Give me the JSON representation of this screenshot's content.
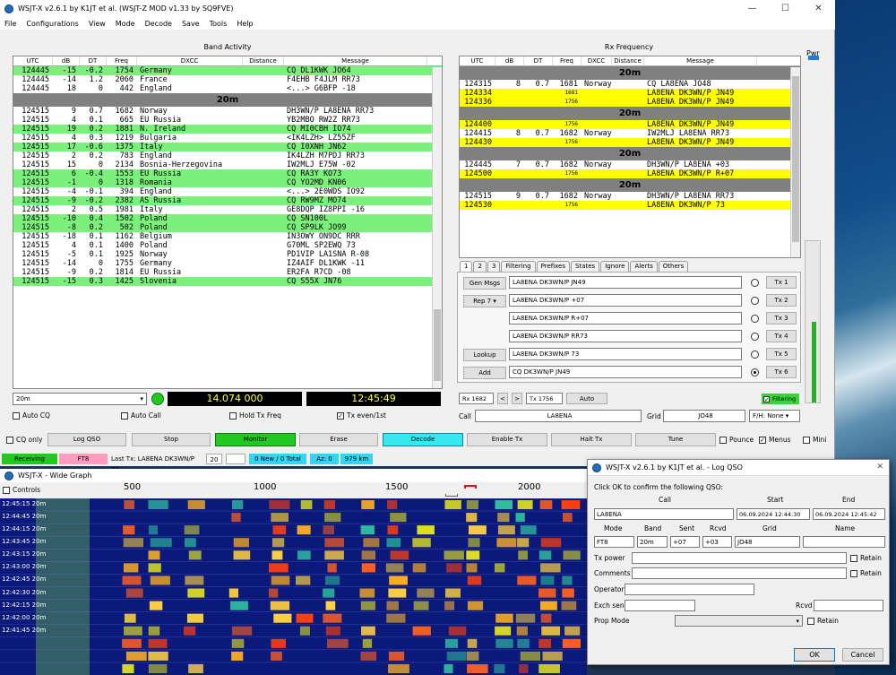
{
  "main": {
    "title": "WSJT-X   v2.6.1   by K1JT et al. (WSJT-Z MOD v1.33 by SQ9FVE)",
    "menu": [
      "File",
      "Configurations",
      "View",
      "Mode",
      "Decode",
      "Save",
      "Tools",
      "Help"
    ],
    "band_activity_title": "Band Activity",
    "rx_freq_title": "Rx Frequency",
    "pwr_label": "Pwr"
  },
  "band": {
    "headers": [
      "UTC",
      "dB",
      "DT",
      "Freq",
      "DXCC",
      "Distance",
      "Message"
    ],
    "rows": [
      {
        "t": "124445",
        "db": "-15",
        "dt": "-0.2",
        "f": "1754",
        "dx": "Germany",
        "dist": "",
        "msg": "CQ DL1KWK JO64",
        "c": "#7bf07b"
      },
      {
        "t": "124445",
        "db": "-14",
        "dt": "1.2",
        "f": "2060",
        "dx": "France",
        "dist": "",
        "msg": "F4EHB F4JLM RR73",
        "c": "#ffffff"
      },
      {
        "t": "124445",
        "db": "18",
        "dt": "0",
        "f": "442",
        "dx": "England",
        "dist": "",
        "msg": "<...> G6BFP -18",
        "c": "#ffffff"
      },
      {
        "sep": "20m"
      },
      {
        "t": "124515",
        "db": "9",
        "dt": "0.7",
        "f": "1682",
        "dx": "Norway",
        "dist": "",
        "msg": "DH3WN/P LA8ENA RR73",
        "c": "#ffffff"
      },
      {
        "t": "124515",
        "db": "4",
        "dt": "0.1",
        "f": "665",
        "dx": "EU Russia",
        "dist": "",
        "msg": "YB2MBO RW2Z RR73",
        "c": "#ffffff"
      },
      {
        "t": "124515",
        "db": "19",
        "dt": "0.2",
        "f": "1881",
        "dx": "N. Ireland",
        "dist": "",
        "msg": "CQ MI0CBH IO74",
        "c": "#7bf07b"
      },
      {
        "t": "124515",
        "db": "4",
        "dt": "0.3",
        "f": "1219",
        "dx": "Bulgaria",
        "dist": "",
        "msg": "<IK4LZH> LZ55ZF",
        "c": "#ffffff"
      },
      {
        "t": "124515",
        "db": "17",
        "dt": "-0.6",
        "f": "1375",
        "dx": "Italy",
        "dist": "",
        "msg": "CQ I0XNH JN62",
        "c": "#7bf07b"
      },
      {
        "t": "124515",
        "db": "2",
        "dt": "0.2",
        "f": "783",
        "dx": "England",
        "dist": "",
        "msg": "IK4LZH M7PDJ RR73",
        "c": "#ffffff"
      },
      {
        "t": "124515",
        "db": "15",
        "dt": "0",
        "f": "2134",
        "dx": "Bosnia-Herzegovina",
        "dist": "",
        "msg": "IW2MLJ E75W -02",
        "c": "#ffffff"
      },
      {
        "t": "124515",
        "db": "6",
        "dt": "-0.4",
        "f": "1553",
        "dx": "EU Russia",
        "dist": "",
        "msg": "CQ RA3Y KO73",
        "c": "#7bf07b"
      },
      {
        "t": "124515",
        "db": "-1",
        "dt": "0",
        "f": "1318",
        "dx": "Romania",
        "dist": "",
        "msg": "CQ YO2MD KN06",
        "c": "#7bf07b"
      },
      {
        "t": "124515",
        "db": "-4",
        "dt": "-0.1",
        "f": "394",
        "dx": "England",
        "dist": "",
        "msg": "<...> 2E0WDS IO92",
        "c": "#ffffff"
      },
      {
        "t": "124515",
        "db": "-9",
        "dt": "-0.2",
        "f": "2382",
        "dx": "AS Russia",
        "dist": "",
        "msg": "CQ RW9MZ MO74",
        "c": "#7bf07b"
      },
      {
        "t": "124515",
        "db": "2",
        "dt": "0.5",
        "f": "1981",
        "dx": "Italy",
        "dist": "",
        "msg": "GE8DQP IZ8PPI -16",
        "c": "#ffffff"
      },
      {
        "t": "124515",
        "db": "-10",
        "dt": "0.4",
        "f": "1502",
        "dx": "Poland",
        "dist": "",
        "msg": "CQ SN100L",
        "c": "#7bf07b"
      },
      {
        "t": "124515",
        "db": "-8",
        "dt": "0.2",
        "f": "502",
        "dx": "Poland",
        "dist": "",
        "msg": "CQ SP9LK JO99",
        "c": "#7bf07b"
      },
      {
        "t": "124515",
        "db": "-18",
        "dt": "0.1",
        "f": "1162",
        "dx": "Belgium",
        "dist": "",
        "msg": "IN3OWY ON9DC RRR",
        "c": "#ffffff"
      },
      {
        "t": "124515",
        "db": "4",
        "dt": "0.1",
        "f": "1400",
        "dx": "Poland",
        "dist": "",
        "msg": "G70ML SP2EWQ 73",
        "c": "#ffffff"
      },
      {
        "t": "124515",
        "db": "-5",
        "dt": "0.1",
        "f": "1925",
        "dx": "Norway",
        "dist": "",
        "msg": "PD1VIP LA1SNA R-08",
        "c": "#ffffff"
      },
      {
        "t": "124515",
        "db": "-14",
        "dt": "0",
        "f": "1755",
        "dx": "Germany",
        "dist": "",
        "msg": "IZ4AIF DL1KWK -11",
        "c": "#ffffff"
      },
      {
        "t": "124515",
        "db": "-9",
        "dt": "0.2",
        "f": "1814",
        "dx": "EU Russia",
        "dist": "",
        "msg": "ER2FA R7CD -08",
        "c": "#ffffff"
      },
      {
        "t": "124515",
        "db": "-15",
        "dt": "0.3",
        "f": "1425",
        "dx": "Slovenia",
        "dist": "",
        "msg": "CQ S55X JN76",
        "c": "#7bf07b"
      }
    ]
  },
  "rx": {
    "headers": [
      "UTC",
      "dB",
      "DT",
      "Freq",
      "DXCC",
      "Distance",
      "Message"
    ],
    "rows": [
      {
        "sep": "20m"
      },
      {
        "t": "124315",
        "db": "8",
        "dt": "0.7",
        "f": "1681",
        "dx": "Norway",
        "dist": "",
        "msg": "CQ LA8ENA JO48",
        "c": "#ffffff"
      },
      {
        "t": "124334",
        "db": "",
        "dt": "",
        "f": "1681",
        "dx": "",
        "dist": "",
        "msg": "LA8ENA DK3WN/P JN49",
        "c": "#ffff00",
        "small": true
      },
      {
        "t": "124336",
        "db": "",
        "dt": "",
        "f": "1756",
        "dx": "",
        "dist": "",
        "msg": "LA8ENA DK3WN/P JN49",
        "c": "#ffff00",
        "small": true
      },
      {
        "sep": "20m"
      },
      {
        "t": "124400",
        "db": "",
        "dt": "",
        "f": "1756",
        "dx": "",
        "dist": "",
        "msg": "LA8ENA DK3WN/P JN49",
        "c": "#ffff00",
        "small": true
      },
      {
        "t": "124415",
        "db": "8",
        "dt": "0.7",
        "f": "1682",
        "dx": "Norway",
        "dist": "",
        "msg": "IW2MLJ LA8ENA RR73",
        "c": "#ffffff"
      },
      {
        "t": "124430",
        "db": "",
        "dt": "",
        "f": "1756",
        "dx": "",
        "dist": "",
        "msg": "LA8ENA DK3WN/P JN49",
        "c": "#ffff00",
        "small": true
      },
      {
        "sep": "20m"
      },
      {
        "t": "124445",
        "db": "7",
        "dt": "0.7",
        "f": "1682",
        "dx": "Norway",
        "dist": "",
        "msg": "DH3WN/P LA8ENA +03",
        "c": "#ffffff"
      },
      {
        "t": "124500",
        "db": "",
        "dt": "",
        "f": "1756",
        "dx": "",
        "dist": "",
        "msg": "LA8ENA DK3WN/P R+07",
        "c": "#ffff00",
        "small": true
      },
      {
        "sep": "20m"
      },
      {
        "t": "124515",
        "db": "9",
        "dt": "0.7",
        "f": "1682",
        "dx": "Norway",
        "dist": "",
        "msg": "DH3WN/P LA8ENA RR73",
        "c": "#ffffff"
      },
      {
        "t": "124530",
        "db": "",
        "dt": "",
        "f": "1756",
        "dx": "",
        "dist": "",
        "msg": "LA8ENA DK3WN/P 73",
        "c": "#ffff00",
        "small": true
      }
    ]
  },
  "tabs": [
    "1",
    "2",
    "3",
    "Filtering",
    "Prefixes",
    "States",
    "Ignore",
    "Alerts",
    "Others"
  ],
  "tx": {
    "gen_msgs": "Gen Msgs",
    "rep": "Rep 7",
    "lookup": "Lookup",
    "add": "Add",
    "msgs": [
      "LA8ENA DK3WN/P JN49",
      "LA8ENA DK3WN/P +07",
      "LA8ENA DK3WN/P R+07",
      "LA8ENA DK3WN/P RR73",
      "LA8ENA DK3WN/P 73",
      "CQ DK3WN/P JN49"
    ],
    "btns": [
      "Tx 1",
      "Tx 2",
      "Tx 3",
      "Tx 4",
      "Tx 5",
      "Tx 6"
    ]
  },
  "controls": {
    "band": "20m",
    "freq": "14.074 000",
    "clock": "12:45:49",
    "auto_cq": "Auto CQ",
    "auto_call": "Auto Call",
    "hold_tx": "Hold Tx Freq",
    "tx_even": "Tx even/1st",
    "rx_freq": "Rx 1682",
    "tx_freq": "Tx 1756",
    "auto": "Auto",
    "filtering": "Filtering",
    "call_label": "Call",
    "call": "LA8ENA",
    "grid_label": "Grid",
    "grid": "JO48",
    "fh": "F/H: None",
    "cq_only": "CQ only",
    "log_qso": "Log QSO",
    "stop": "Stop",
    "monitor": "Monitor",
    "erase": "Erase",
    "decode": "Decode",
    "enable_tx": "Enable Tx",
    "halt_tx": "Halt Tx",
    "tune": "Tune",
    "pounce": "Pounce",
    "menus": "Menus",
    "mini": "Mini"
  },
  "status": {
    "receiving": "Receiving",
    "mode": "FT8",
    "last_tx": "Last Tx: LA8ENA DK3WN/P 73",
    "num": "20",
    "new_total": "0 New / 0 Total",
    "az": "Az: 0",
    "km": "979 km"
  },
  "wide": {
    "title": "WSJT-X - Wide Graph",
    "controls": "Controls",
    "scale": [
      "500",
      "1000",
      "1500",
      "2000"
    ],
    "times": [
      "12:45:15",
      "12:44:45",
      "12:44:15",
      "12:43:45",
      "12:43:15",
      "12:43:00",
      "12:42:45",
      "12:42:30",
      "12:42:15",
      "12:42:00",
      "12:41:45"
    ],
    "band": "20m"
  },
  "dialog": {
    "title": "WSJT-X   v2.6.1   by K1JT et al. - Log QSO",
    "prompt": "Click OK to confirm the following QSO:",
    "call_label": "Call",
    "start_label": "Start",
    "end_label": "End",
    "call": "LA8ENA",
    "start": "06.09.2024 12:44:30",
    "end": "06.09.2024 12:45:42",
    "mode_label": "Mode",
    "band_label": "Band",
    "sent_label": "Sent",
    "rcvd_label": "Rcvd",
    "grid_label": "Grid",
    "name_label": "Name",
    "mode": "FT8",
    "band": "20m",
    "sent": "+07",
    "rcvd": "+03",
    "grid": "JO48",
    "txpower": "Tx power",
    "comments": "Comments",
    "operator": "Operator",
    "exch_sent": "Exch sent",
    "rcvd2": "Rcvd",
    "prop_mode": "Prop Mode",
    "retain": "Retain",
    "ok": "OK",
    "cancel": "Cancel"
  }
}
